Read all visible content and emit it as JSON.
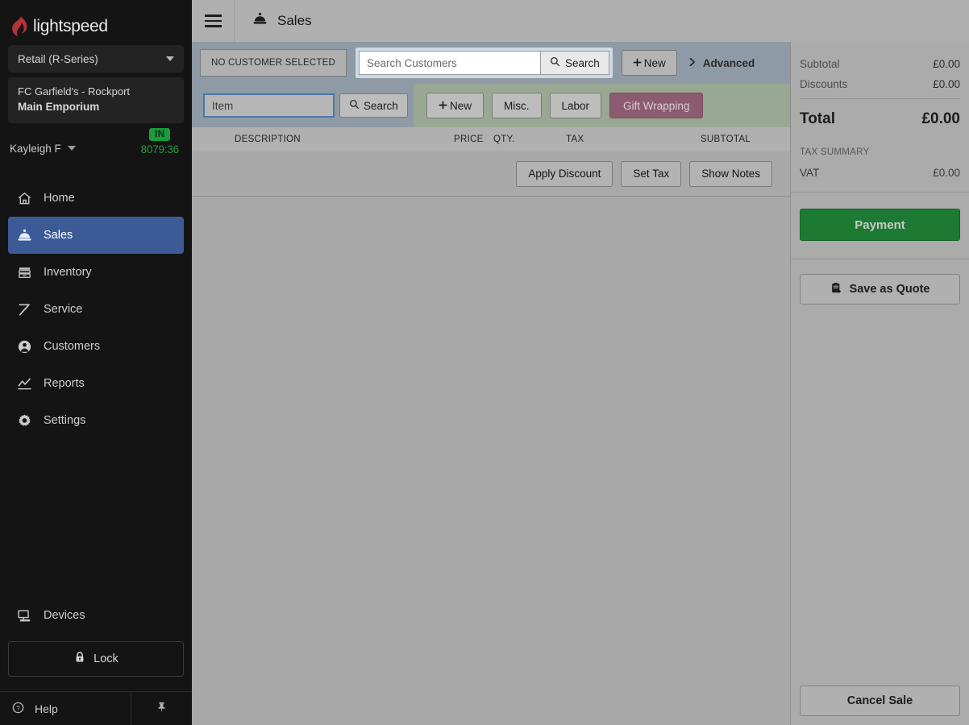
{
  "brand": {
    "name": "lightspeed",
    "logo_icon": "lightspeed-flame-icon",
    "flame_color": "#b3333a"
  },
  "sidebar": {
    "product_select": {
      "value": "Retail (R-Series)",
      "icon": "chevron-down-icon"
    },
    "store": {
      "line1": "FC Garfield's - Rockport",
      "line2": "Main Emporium"
    },
    "user": {
      "name": "Kayleigh F",
      "caret_icon": "chevron-down-icon"
    },
    "clock": {
      "status": "IN",
      "elapsed": "8079:36",
      "status_color": "#199c3a",
      "timer_color": "#1f9c3e"
    },
    "nav": [
      {
        "label": "Home",
        "icon": "home-icon",
        "active": false
      },
      {
        "label": "Sales",
        "icon": "sales-bell-icon",
        "active": true
      },
      {
        "label": "Inventory",
        "icon": "inventory-box-icon",
        "active": false
      },
      {
        "label": "Service",
        "icon": "hammer-icon",
        "active": false
      },
      {
        "label": "Customers",
        "icon": "user-circle-icon",
        "active": false
      },
      {
        "label": "Reports",
        "icon": "chart-line-icon",
        "active": false
      },
      {
        "label": "Settings",
        "icon": "gear-icon",
        "active": false
      }
    ],
    "devices": {
      "label": "Devices",
      "icon": "monitor-icon"
    },
    "lock": {
      "label": "Lock",
      "icon": "lock-icon"
    },
    "help": {
      "label": "Help",
      "icon": "question-circle-icon"
    },
    "pin": {
      "icon": "pushpin-icon"
    },
    "active_accent": "#3c5a96"
  },
  "topbar": {
    "menu_icon": "hamburger-menu-icon",
    "page_icon": "sales-bell-icon",
    "title": "Sales"
  },
  "customer_bar": {
    "no_customer_label": "NO CUSTOMER SELECTED",
    "search_placeholder": "Search Customers",
    "search_value": "",
    "search_button": "Search",
    "search_icon": "magnifier-icon",
    "new_button": "New",
    "new_icon": "plus-icon",
    "advanced_label": "Advanced",
    "advanced_icon": "chevron-right-icon"
  },
  "item_bar": {
    "item_placeholder": "Item",
    "item_value": "",
    "search_button": "Search",
    "search_icon": "magnifier-icon",
    "new_button": "New",
    "new_icon": "plus-icon",
    "misc_button": "Misc.",
    "labor_button": "Labor",
    "gift_button": "Gift Wrapping",
    "gift_color": "#8d5b70"
  },
  "line_table": {
    "columns": {
      "description": "DESCRIPTION",
      "price": "PRICE",
      "qty": "QTY.",
      "tax": "TAX",
      "subtotal": "SUBTOTAL"
    },
    "rows": []
  },
  "line_actions": {
    "apply_discount": "Apply Discount",
    "set_tax": "Set Tax",
    "show_notes": "Show Notes"
  },
  "totals": {
    "subtotal_label": "Subtotal",
    "subtotal_value": "£0.00",
    "discounts_label": "Discounts",
    "discounts_value": "£0.00",
    "total_label": "Total",
    "total_value": "£0.00",
    "tax_summary_label": "TAX SUMMARY",
    "tax_name": "VAT",
    "tax_value": "£0.00"
  },
  "actions": {
    "payment": "Payment",
    "payment_color": "#1d7a32",
    "save_quote": "Save as Quote",
    "save_quote_icon": "clipboard-icon",
    "cancel_sale": "Cancel Sale"
  }
}
